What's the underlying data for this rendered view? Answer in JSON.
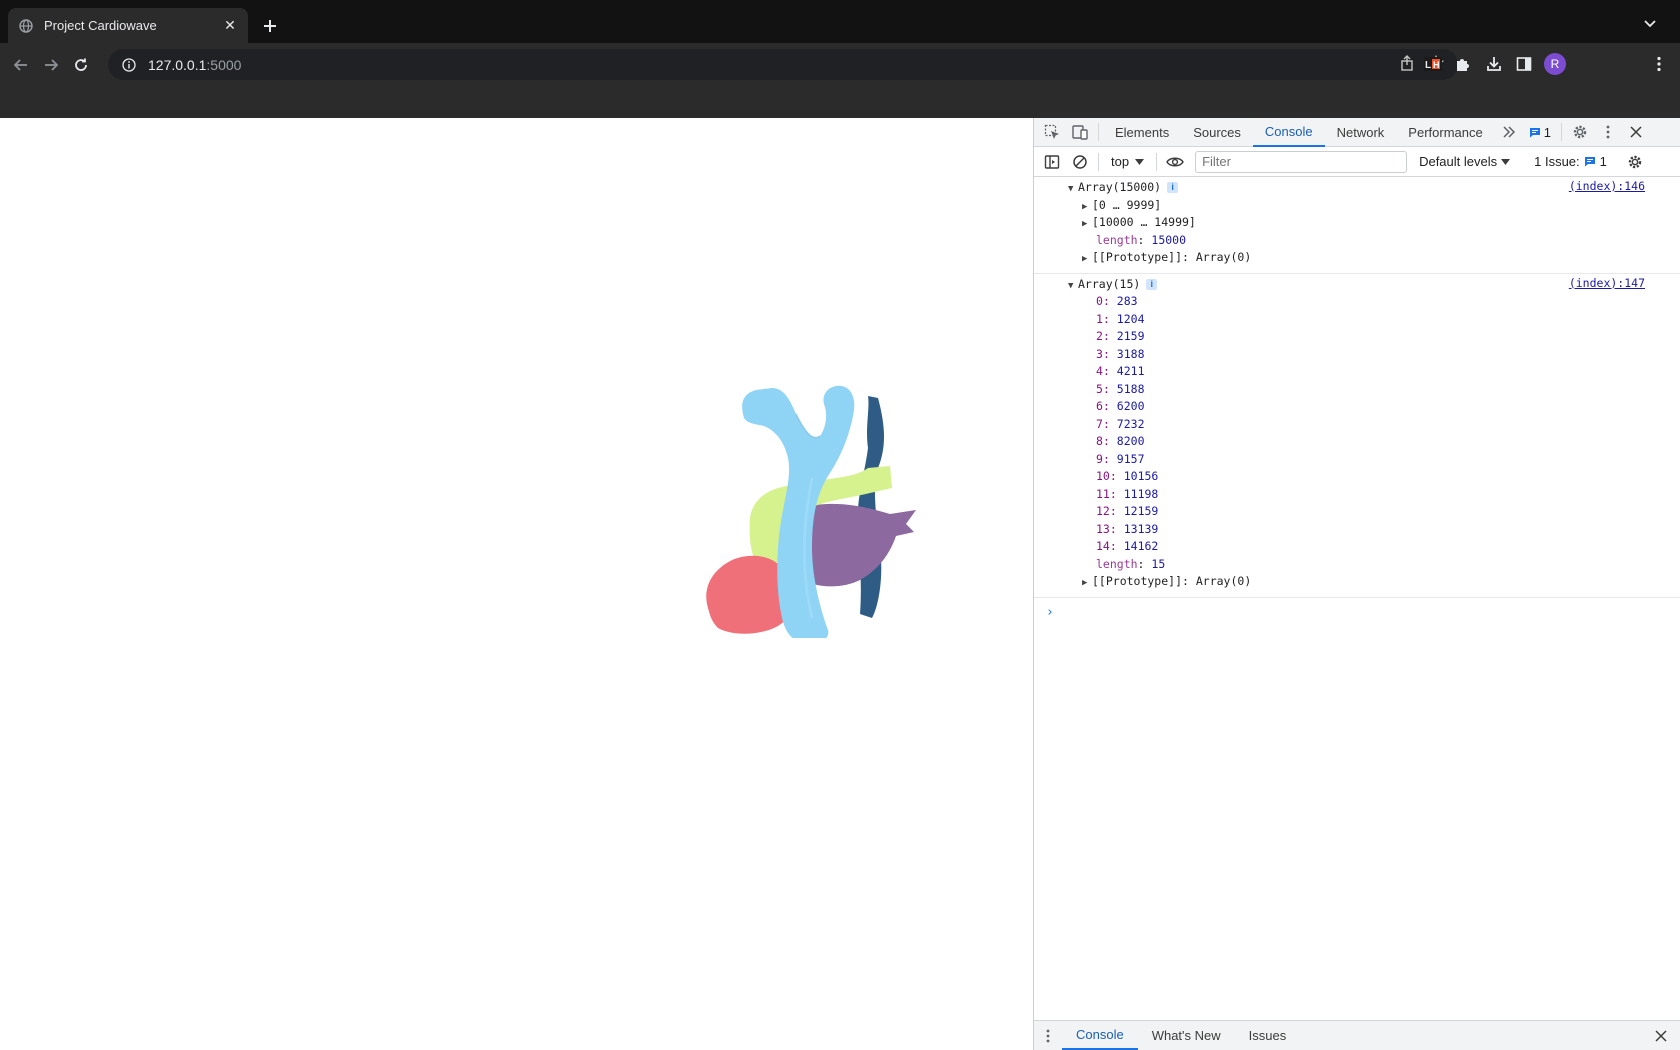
{
  "browser": {
    "tab_title": "Project Cardiowave",
    "url_host": "127.0.0.1",
    "url_port": ":5000",
    "avatar_letter": "R"
  },
  "devtools": {
    "tabs": [
      "Elements",
      "Sources",
      "Console",
      "Network",
      "Performance"
    ],
    "active_tab": "Console",
    "messages_badge": "1",
    "context": "top",
    "filter_placeholder": "Filter",
    "levels": "Default levels",
    "issues_label": "1 Issue:",
    "issues_count": "1",
    "drawer_tabs": [
      "Console",
      "What's New",
      "Issues"
    ]
  },
  "console": {
    "entry1": {
      "header": "Array(15000)",
      "source": "(index):146",
      "range1": "[0 … 9999]",
      "range2": "[10000 … 14999]",
      "length_key": "length",
      "length_value": "15000",
      "proto": "[[Prototype]]: Array(0)"
    },
    "entry2": {
      "header": "Array(15)",
      "source": "(index):147",
      "items": [
        {
          "k": "0",
          "v": "283"
        },
        {
          "k": "1",
          "v": "1204"
        },
        {
          "k": "2",
          "v": "2159"
        },
        {
          "k": "3",
          "v": "3188"
        },
        {
          "k": "4",
          "v": "4211"
        },
        {
          "k": "5",
          "v": "5188"
        },
        {
          "k": "6",
          "v": "6200"
        },
        {
          "k": "7",
          "v": "7232"
        },
        {
          "k": "8",
          "v": "8200"
        },
        {
          "k": "9",
          "v": "9157"
        },
        {
          "k": "10",
          "v": "10156"
        },
        {
          "k": "11",
          "v": "11198"
        },
        {
          "k": "12",
          "v": "12159"
        },
        {
          "k": "13",
          "v": "13139"
        },
        {
          "k": "14",
          "v": "14162"
        }
      ],
      "length_key": "length",
      "length_value": "15",
      "proto": "[[Prototype]]: Array(0)"
    }
  },
  "colors": {
    "aorta": "#8fd3f5",
    "dark_vessel": "#2f5c85",
    "green_vessel": "#d5f28e",
    "purple_chamber": "#8c6a9f",
    "red_chamber": "#f0707a"
  }
}
